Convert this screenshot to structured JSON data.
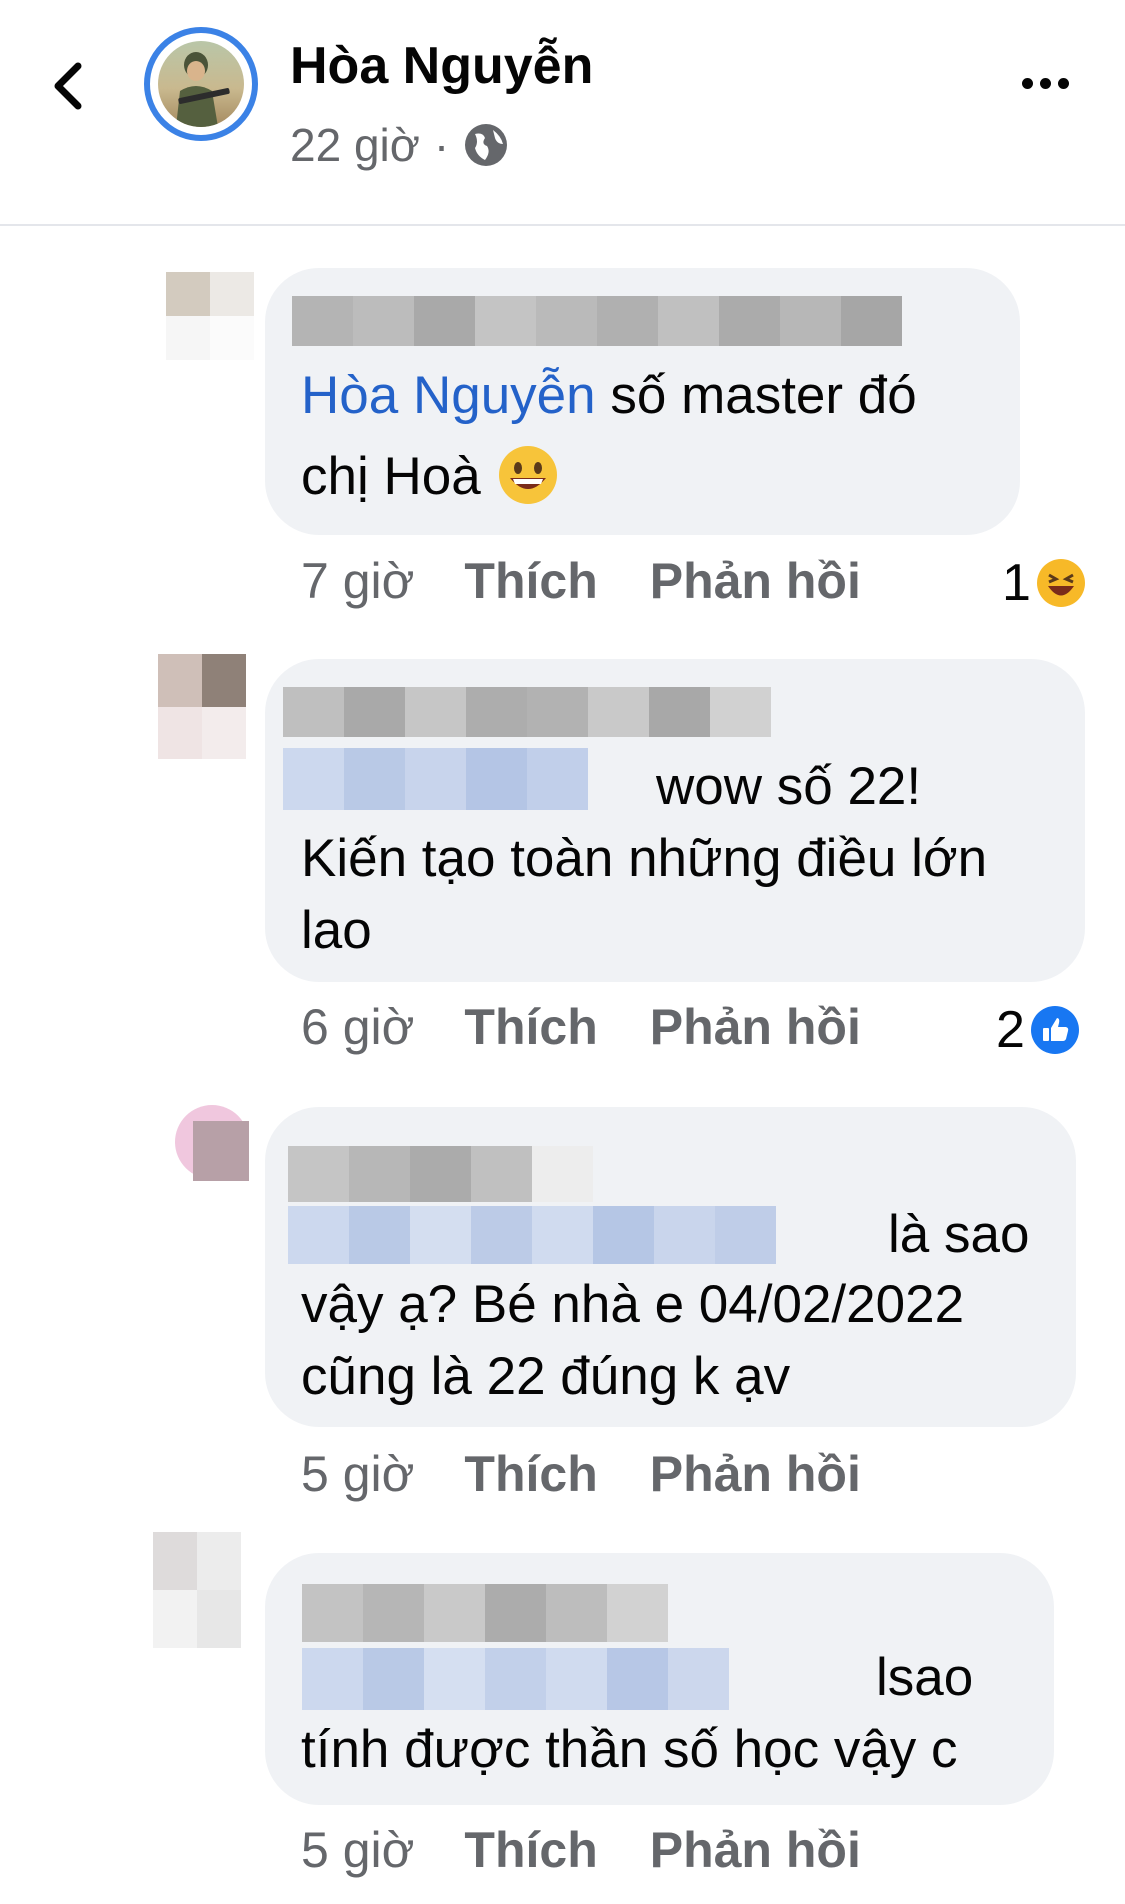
{
  "post_header": {
    "author_name": "Hòa Nguyễn",
    "time": "22 giờ",
    "separator": "·",
    "privacy_icon": "globe-icon",
    "back_icon": "chevron-left-icon",
    "more_icon": "more-dots-icon"
  },
  "action_labels": {
    "like": "Thích",
    "reply": "Phản hồi"
  },
  "comments": [
    {
      "mention": "Hòa Nguyễn",
      "line1_rest": " số master đó",
      "line2": "chị Hoà",
      "emoji": "grinning-face-icon",
      "time": "7 giờ",
      "reaction_count": "1",
      "reaction_icon": "haha-reaction-icon"
    },
    {
      "line1_tail": "wow số 22!",
      "line2": "Kiến tạo toàn những điều lớn",
      "line3": "lao",
      "time": "6 giờ",
      "reaction_count": "2",
      "reaction_icon": "like-reaction-icon"
    },
    {
      "line1_tail": "là sao",
      "line2": "vậy ạ? Bé nhà e 04/02/2022",
      "line3": "cũng là 22 đúng k ạv",
      "time": "5 giờ"
    },
    {
      "line1_tail": "lsao",
      "line2": "tính được thần số học vậy c",
      "time": "5 giờ"
    }
  ],
  "colors": {
    "mention_blue": "#2462c9",
    "bubble_bg": "#f0f2f5",
    "like_blue": "#1877f2",
    "haha_yellow": "#f7b928"
  }
}
